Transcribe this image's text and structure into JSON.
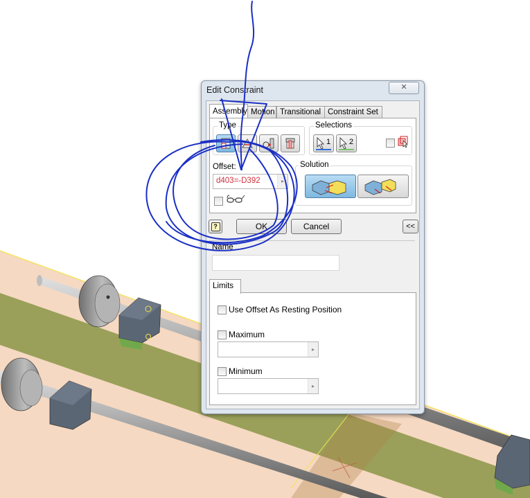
{
  "dialog": {
    "title": "Edit Constraint",
    "close_glyph": "✕",
    "tabs": [
      {
        "label": "Assembly",
        "active": true
      },
      {
        "label": "Motion",
        "active": false
      },
      {
        "label": "Transitional",
        "active": false
      },
      {
        "label": "Constraint Set",
        "active": false
      }
    ],
    "type_group": {
      "label": "Type",
      "buttons": [
        {
          "name": "mate-constraint",
          "active": true
        },
        {
          "name": "angle-constraint",
          "active": false
        },
        {
          "name": "tangent-constraint",
          "active": false
        },
        {
          "name": "insert-constraint",
          "active": false
        }
      ]
    },
    "selections_group": {
      "label": "Selections",
      "buttons": [
        {
          "label": "1",
          "underline_color": "#2f6fd6"
        },
        {
          "label": "2",
          "underline_color": "#79c26d"
        }
      ],
      "pick_part_first_checked": false
    },
    "offset": {
      "label": "Offset:",
      "value": "d403=-D392",
      "value_color": "#d0303c",
      "preview_checked": false
    },
    "solution_group": {
      "label": "Solution",
      "options": [
        {
          "name": "mate",
          "active": true
        },
        {
          "name": "flush",
          "active": false
        }
      ]
    },
    "help_glyph": "?",
    "ok_label": "OK",
    "cancel_label": "Cancel",
    "more_label": "<<",
    "name_label": "Name",
    "name_value": "",
    "limits_tab": "Limits",
    "limits": {
      "use_offset_label": "Use Offset As Resting Position",
      "use_offset_checked": false,
      "maximum_label": "Maximum",
      "maximum_checked": false,
      "maximum_value": "",
      "minimum_label": "Minimum",
      "minimum_checked": false,
      "minimum_value": ""
    }
  },
  "colors": {
    "annotation_ink": "#1a2fc4",
    "plate_peach": "#f6d9c2",
    "plate_green": "#9aa05a",
    "edge_highlight": "#f3e34a"
  }
}
